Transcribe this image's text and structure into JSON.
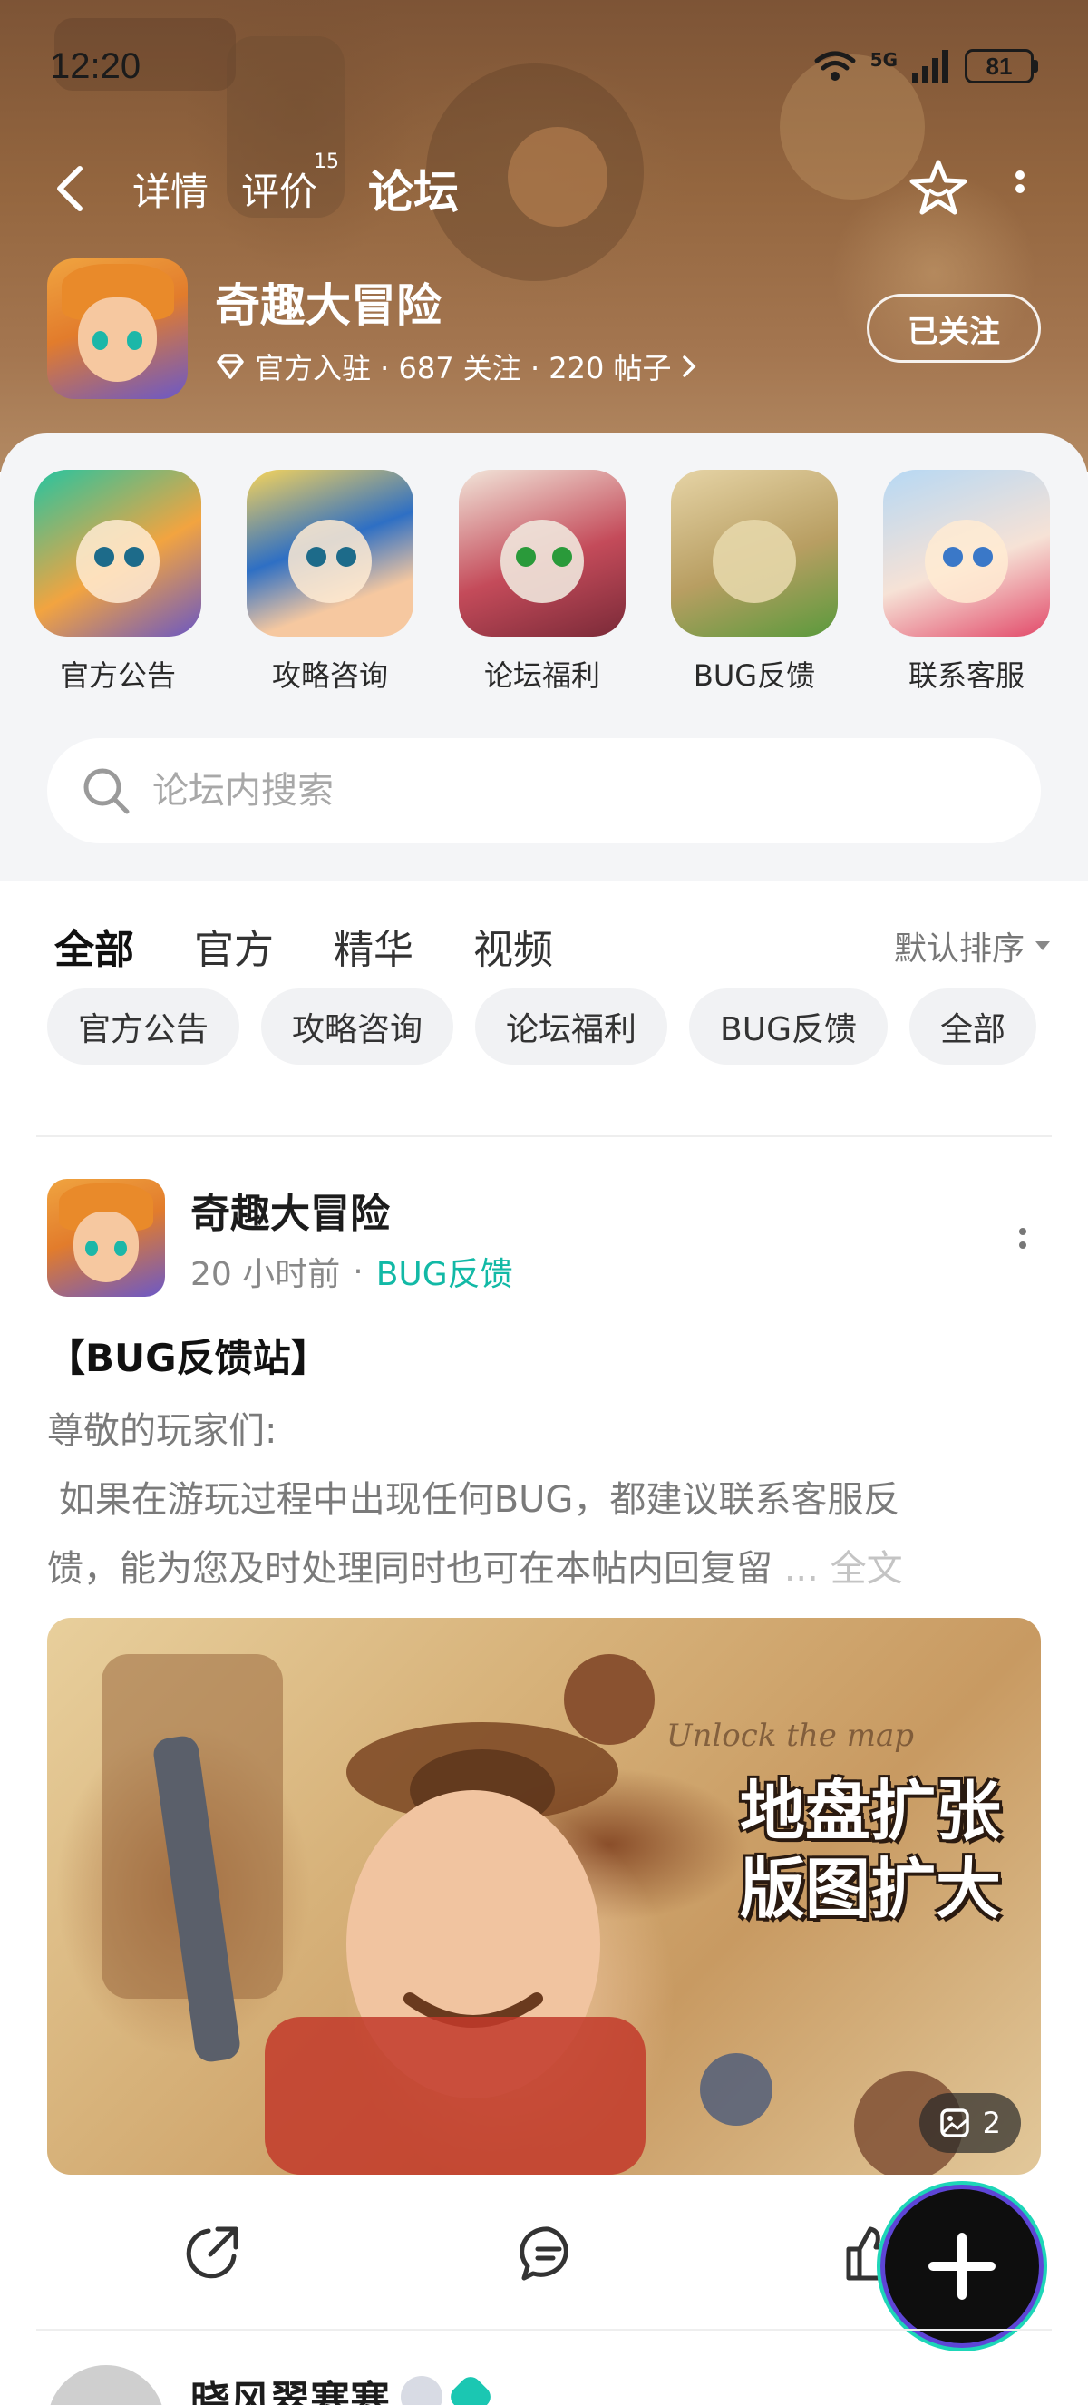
{
  "status_bar": {
    "time": "12:20",
    "network": "5G",
    "battery": "81"
  },
  "nav": {
    "tabs": [
      {
        "label": "详情"
      },
      {
        "label": "评价",
        "badge": "15"
      },
      {
        "label": "论坛"
      }
    ],
    "active_tab": "论坛"
  },
  "game": {
    "name": "奇趣大冒险",
    "meta": "官方入驻 · 687 关注 · 220 帖子",
    "follow_label": "已关注"
  },
  "shortcuts": [
    {
      "label": "官方公告"
    },
    {
      "label": "攻略咨询"
    },
    {
      "label": "论坛福利"
    },
    {
      "label": "BUG反馈"
    },
    {
      "label": "联系客服"
    }
  ],
  "search": {
    "placeholder": "论坛内搜索"
  },
  "feed_tabs": [
    {
      "label": "全部"
    },
    {
      "label": "官方"
    },
    {
      "label": "精华"
    },
    {
      "label": "视频"
    }
  ],
  "sort_label": "默认排序",
  "chips": [
    {
      "label": "官方公告"
    },
    {
      "label": "攻略咨询"
    },
    {
      "label": "论坛福利"
    },
    {
      "label": "BUG反馈"
    },
    {
      "label": "全部"
    }
  ],
  "post": {
    "author": "奇趣大冒险",
    "time": "20 小时前",
    "category": "BUG反馈",
    "title": "【BUG反馈站】",
    "body_line1": "尊敬的玩家们:",
    "body_line2": " 如果在游玩过程中出现任何BUG，都建议联系客服反",
    "body_line3": "馈，能为您及时处理同时也可在本帖内回复留",
    "ellipsis": " ... ",
    "full_text": "全文",
    "image_script": "Unlock the map",
    "image_headline_1": "地盘扩张",
    "image_headline_2": "版图扩大",
    "image_count": "2"
  },
  "next_post": {
    "author": "晓风翠寒寒"
  },
  "colors": {
    "accent": "#16c9b3",
    "category_text": "#12b9a6",
    "hero_brown": "#94663f"
  },
  "icons": [
    "back-icon",
    "star-icon",
    "more-vertical-icon",
    "diamond-icon",
    "chevron-right-icon",
    "search-icon",
    "sort-triangle-icon",
    "share-icon",
    "comment-icon",
    "like-icon",
    "plus-icon",
    "image-icon"
  ]
}
